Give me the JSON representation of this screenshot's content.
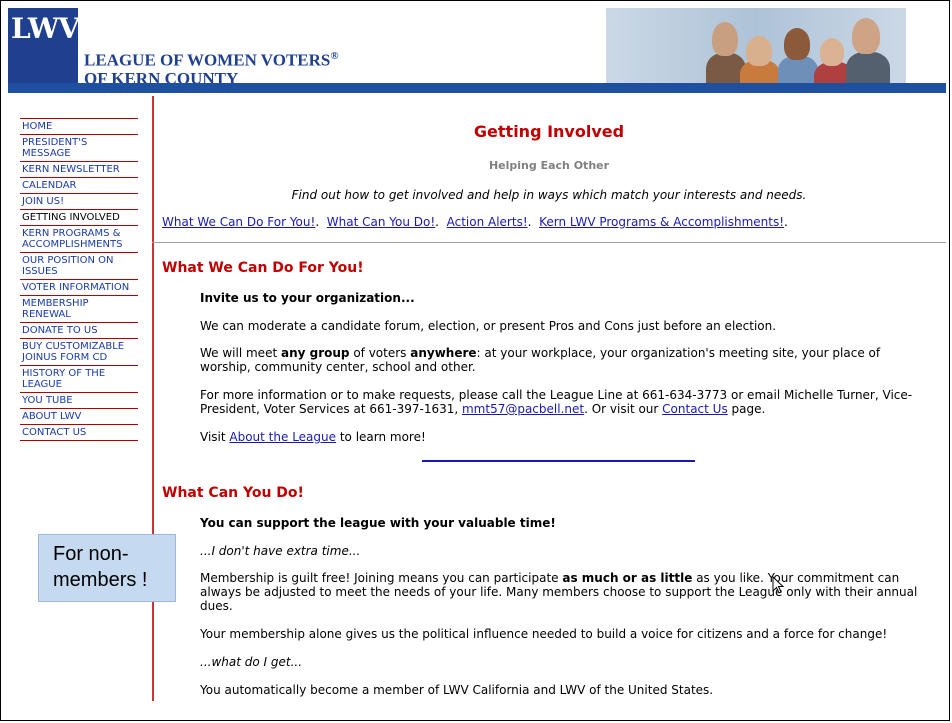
{
  "header": {
    "logo_text": "LWV",
    "org_line1": "LEAGUE OF WOMEN VOTERS",
    "org_reg": "®",
    "org_line2": "OF KERN COUNTY"
  },
  "sidebar": {
    "items": [
      {
        "label": "HOME"
      },
      {
        "label": "PRESIDENT'S MESSAGE"
      },
      {
        "label": "KERN NEWSLETTER"
      },
      {
        "label": "CALENDAR"
      },
      {
        "label": "JOIN US!"
      },
      {
        "label": "GETTING INVOLVED"
      },
      {
        "label": "KERN PROGRAMS & ACCOMPLISHMENTS"
      },
      {
        "label": "OUR POSITION ON ISSUES"
      },
      {
        "label": "VOTER INFORMATION"
      },
      {
        "label": "MEMBERSHIP RENEWAL"
      },
      {
        "label": "DONATE TO US"
      },
      {
        "label": "BUY CUSTOMIZABLE JOINUS FORM CD"
      },
      {
        "label": "HISTORY OF THE LEAGUE"
      },
      {
        "label": "YOU TUBE"
      },
      {
        "label": "ABOUT LWV"
      },
      {
        "label": "CONTACT US"
      }
    ]
  },
  "callout": {
    "text": "For non-members !"
  },
  "main": {
    "title": "Getting Involved",
    "subtitle": "Helping Each Other",
    "intro": "Find out how to get involved and help in ways which match your interests and needs.",
    "links": [
      "What We Can Do For You!",
      "What Can You Do!",
      "Action Alerts!",
      "Kern LWV Programs & Accomplishments!"
    ],
    "section1": {
      "heading": "What We Can Do For You!",
      "lead": "Invite us to your organization...",
      "p1": "We can moderate a candidate forum, election, or present Pros and Cons just before an election.",
      "p2_a": "We will meet ",
      "p2_b": "any group",
      "p2_c": " of voters ",
      "p2_d": "anywhere",
      "p2_e": ": at your workplace, your organization's meeting site, your place of worship, community center, school and other.",
      "p3_a": "For more information or to make requests, please call the League Line at 661-634-3773 or email Michelle Turner, Vice-President, Voter Services at 661-397-1631, ",
      "p3_email": "mmt57@pacbell.net",
      "p3_b": ". Or visit our ",
      "p3_link": "Contact Us",
      "p3_c": " page.",
      "p4_a": "Visit ",
      "p4_link": "About the League",
      "p4_b": " to learn more!"
    },
    "section2": {
      "heading": "What Can You Do!",
      "lead": "You can support the league with your valuable time!",
      "q1": "...I don't have extra time...",
      "p1_a": "Membership is guilt free! Joining means you can participate ",
      "p1_b": "as much or as little",
      "p1_c": " as you like. Your commitment can always be adjusted to meet the needs of your life. Many members choose to support the League only with their annual dues.",
      "p2": "Your membership alone gives us the political influence needed to build a voice for citizens and a force for change!",
      "q2": "...what do I get...",
      "p3": "You automatically become a member of LWV California and LWV of the United States."
    }
  }
}
